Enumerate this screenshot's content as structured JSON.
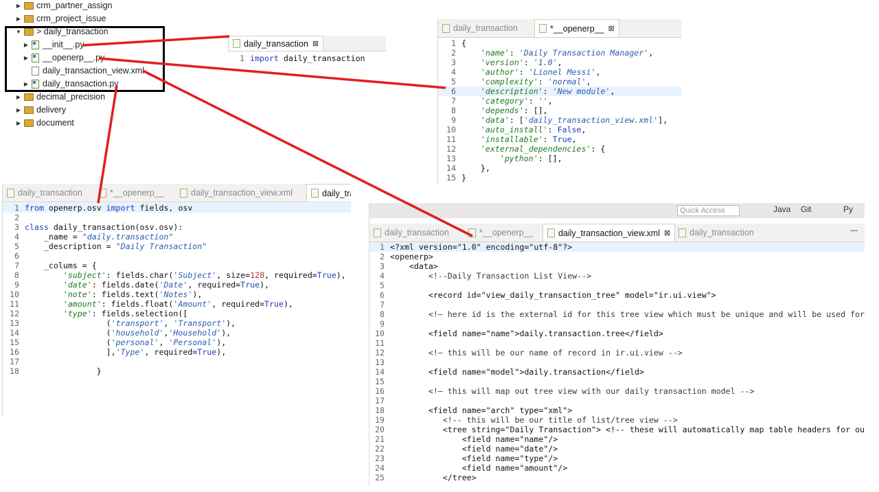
{
  "explorer": {
    "items": [
      {
        "label": "crm_partner_assign",
        "kind": "folder",
        "arrow": "▶"
      },
      {
        "label": "crm_project_issue",
        "kind": "folder",
        "arrow": "▶"
      },
      {
        "label": "> daily_transaction",
        "kind": "folder",
        "arrow": "▼"
      },
      {
        "label": "__init__.py",
        "kind": "py",
        "arrow": "▶"
      },
      {
        "label": "__openerp__.py",
        "kind": "py",
        "arrow": "▶"
      },
      {
        "label": "daily_transaction_view.xml",
        "kind": "xml",
        "arrow": ""
      },
      {
        "label": "daily_transaction.py",
        "kind": "py",
        "arrow": "▶"
      },
      {
        "label": "decimal_precision",
        "kind": "folder",
        "arrow": "▶"
      },
      {
        "label": "delivery",
        "kind": "folder",
        "arrow": "▶"
      },
      {
        "label": "document",
        "kind": "folder",
        "arrow": "▶"
      }
    ]
  },
  "init_editor": {
    "tabs": [
      {
        "label": "daily_transaction",
        "active": true,
        "close": "⊠"
      }
    ],
    "lines": [
      {
        "n": "1",
        "segs": [
          {
            "t": "import",
            "c": "kw"
          },
          {
            "t": " daily_transaction",
            "c": ""
          }
        ]
      }
    ]
  },
  "openerp_editor": {
    "tabs": [
      {
        "label": "daily_transaction",
        "active": false,
        "close": ""
      },
      {
        "label": "*__openerp__",
        "active": true,
        "close": "⊠"
      }
    ],
    "lines": [
      {
        "n": "1",
        "segs": [
          {
            "t": "{",
            "c": ""
          }
        ]
      },
      {
        "n": "2",
        "segs": [
          {
            "t": "    'name'",
            "c": "key"
          },
          {
            "t": ": ",
            "c": ""
          },
          {
            "t": "'Daily Transaction Manager'",
            "c": "str"
          },
          {
            "t": ",",
            "c": ""
          }
        ]
      },
      {
        "n": "3",
        "segs": [
          {
            "t": "    'version'",
            "c": "key"
          },
          {
            "t": ": ",
            "c": ""
          },
          {
            "t": "'1.0'",
            "c": "str"
          },
          {
            "t": ",",
            "c": ""
          }
        ]
      },
      {
        "n": "4",
        "segs": [
          {
            "t": "    'author'",
            "c": "key"
          },
          {
            "t": ": ",
            "c": ""
          },
          {
            "t": "'Lionel Messi'",
            "c": "str"
          },
          {
            "t": ",",
            "c": ""
          }
        ]
      },
      {
        "n": "5",
        "segs": [
          {
            "t": "    'complexity'",
            "c": "key"
          },
          {
            "t": ": ",
            "c": ""
          },
          {
            "t": "'normal'",
            "c": "str"
          },
          {
            "t": ",",
            "c": ""
          }
        ]
      },
      {
        "n": "6",
        "segs": [
          {
            "t": "    'description'",
            "c": "key"
          },
          {
            "t": ": ",
            "c": ""
          },
          {
            "t": "'New module'",
            "c": "str"
          },
          {
            "t": ",",
            "c": ""
          }
        ],
        "current": true
      },
      {
        "n": "7",
        "segs": [
          {
            "t": "    'category'",
            "c": "key"
          },
          {
            "t": ": ",
            "c": ""
          },
          {
            "t": "''",
            "c": "str"
          },
          {
            "t": ",",
            "c": ""
          }
        ]
      },
      {
        "n": "8",
        "segs": [
          {
            "t": "    'depends'",
            "c": "key"
          },
          {
            "t": ": [],",
            "c": ""
          }
        ]
      },
      {
        "n": "9",
        "segs": [
          {
            "t": "    'data'",
            "c": "key"
          },
          {
            "t": ": [",
            "c": ""
          },
          {
            "t": "'daily_transaction_view.xml'",
            "c": "str"
          },
          {
            "t": "],",
            "c": ""
          }
        ]
      },
      {
        "n": "10",
        "segs": [
          {
            "t": "    'auto_install'",
            "c": "key"
          },
          {
            "t": ": ",
            "c": ""
          },
          {
            "t": "False",
            "c": "bool"
          },
          {
            "t": ",",
            "c": ""
          }
        ]
      },
      {
        "n": "11",
        "segs": [
          {
            "t": "    'installable'",
            "c": "key"
          },
          {
            "t": ": ",
            "c": ""
          },
          {
            "t": "True",
            "c": "bool"
          },
          {
            "t": ",",
            "c": ""
          }
        ]
      },
      {
        "n": "12",
        "segs": [
          {
            "t": "    'external_dependencies'",
            "c": "key"
          },
          {
            "t": ": {",
            "c": ""
          }
        ]
      },
      {
        "n": "13",
        "segs": [
          {
            "t": "        'python'",
            "c": "key"
          },
          {
            "t": ": [],",
            "c": ""
          }
        ]
      },
      {
        "n": "14",
        "segs": [
          {
            "t": "    },",
            "c": ""
          }
        ]
      },
      {
        "n": "15",
        "segs": [
          {
            "t": "}",
            "c": ""
          }
        ]
      }
    ]
  },
  "model_editor": {
    "tabs": [
      {
        "label": "daily_transaction",
        "active": false,
        "close": ""
      },
      {
        "label": "*__openerp__",
        "active": false,
        "close": ""
      },
      {
        "label": "daily_transaction_view.xml",
        "active": false,
        "close": ""
      },
      {
        "label": "daily_tra",
        "active": true,
        "close": ""
      }
    ],
    "lines": [
      {
        "n": "1",
        "segs": [
          {
            "t": "from",
            "c": "kw"
          },
          {
            "t": " openerp.osv ",
            "c": ""
          },
          {
            "t": "import",
            "c": "kw"
          },
          {
            "t": " fields, osv",
            "c": ""
          }
        ],
        "current": true
      },
      {
        "n": "2",
        "segs": []
      },
      {
        "n": "3",
        "segs": [
          {
            "t": "class",
            "c": "kw"
          },
          {
            "t": " daily_transaction(osv.osv):",
            "c": ""
          }
        ]
      },
      {
        "n": "4",
        "segs": [
          {
            "t": "    _name = ",
            "c": ""
          },
          {
            "t": "\"daily.transaction\"",
            "c": "str"
          }
        ]
      },
      {
        "n": "5",
        "segs": [
          {
            "t": "    _description = ",
            "c": ""
          },
          {
            "t": "\"Daily Transaction\"",
            "c": "str"
          }
        ]
      },
      {
        "n": "6",
        "segs": []
      },
      {
        "n": "7",
        "segs": [
          {
            "t": "    _colums = {",
            "c": ""
          }
        ]
      },
      {
        "n": "8",
        "segs": [
          {
            "t": "        'subject'",
            "c": "key"
          },
          {
            "t": ": fields.char(",
            "c": ""
          },
          {
            "t": "'Subject'",
            "c": "str"
          },
          {
            "t": ", size=",
            "c": ""
          },
          {
            "t": "128",
            "c": "num"
          },
          {
            "t": ", required=",
            "c": ""
          },
          {
            "t": "True",
            "c": "bool"
          },
          {
            "t": "),",
            "c": ""
          }
        ]
      },
      {
        "n": "9",
        "segs": [
          {
            "t": "        'date'",
            "c": "key"
          },
          {
            "t": ": fields.date(",
            "c": ""
          },
          {
            "t": "'Date'",
            "c": "str"
          },
          {
            "t": ", required=",
            "c": ""
          },
          {
            "t": "True",
            "c": "bool"
          },
          {
            "t": "),",
            "c": ""
          }
        ]
      },
      {
        "n": "10",
        "segs": [
          {
            "t": "        'note'",
            "c": "key"
          },
          {
            "t": ": fields.text(",
            "c": ""
          },
          {
            "t": "'Notes'",
            "c": "str"
          },
          {
            "t": "),",
            "c": ""
          }
        ]
      },
      {
        "n": "11",
        "segs": [
          {
            "t": "        'amount'",
            "c": "key"
          },
          {
            "t": ": fields.float(",
            "c": ""
          },
          {
            "t": "'Amount'",
            "c": "str"
          },
          {
            "t": ", required=",
            "c": ""
          },
          {
            "t": "True",
            "c": "bool"
          },
          {
            "t": "),",
            "c": ""
          }
        ]
      },
      {
        "n": "12",
        "segs": [
          {
            "t": "        'type'",
            "c": "key"
          },
          {
            "t": ": fields.selection([",
            "c": ""
          }
        ]
      },
      {
        "n": "13",
        "segs": [
          {
            "t": "                 (",
            "c": ""
          },
          {
            "t": "'transport'",
            "c": "str"
          },
          {
            "t": ", ",
            "c": ""
          },
          {
            "t": "'Transport'",
            "c": "str"
          },
          {
            "t": "),",
            "c": ""
          }
        ]
      },
      {
        "n": "14",
        "segs": [
          {
            "t": "                 (",
            "c": ""
          },
          {
            "t": "'household'",
            "c": "str"
          },
          {
            "t": ",",
            "c": ""
          },
          {
            "t": "'Household'",
            "c": "str"
          },
          {
            "t": "),",
            "c": ""
          }
        ]
      },
      {
        "n": "15",
        "segs": [
          {
            "t": "                 (",
            "c": ""
          },
          {
            "t": "'personal'",
            "c": "str"
          },
          {
            "t": ", ",
            "c": ""
          },
          {
            "t": "'Personal'",
            "c": "str"
          },
          {
            "t": "),",
            "c": ""
          }
        ]
      },
      {
        "n": "16",
        "segs": [
          {
            "t": "                 ],",
            "c": ""
          },
          {
            "t": "'Type'",
            "c": "str"
          },
          {
            "t": ", required=",
            "c": ""
          },
          {
            "t": "True",
            "c": "bool"
          },
          {
            "t": "),",
            "c": ""
          }
        ]
      },
      {
        "n": "17",
        "segs": []
      },
      {
        "n": "18",
        "segs": [
          {
            "t": "               }",
            "c": ""
          }
        ]
      }
    ]
  },
  "view_editor": {
    "quick_access": "Quick Access",
    "perspectives": [
      "Java",
      "Git",
      "Py"
    ],
    "tabs": [
      {
        "label": "daily_transaction",
        "active": false,
        "close": ""
      },
      {
        "label": "*__openerp__",
        "active": false,
        "close": ""
      },
      {
        "label": "daily_transaction_view.xml",
        "active": true,
        "close": "⊠"
      },
      {
        "label": "daily_transaction",
        "active": false,
        "close": ""
      }
    ],
    "minimize": "—",
    "lines": [
      {
        "n": "1",
        "segs": [
          {
            "t": "<?xml version=\"1.0\" encoding=\"utf-8\"?>",
            "c": ""
          }
        ],
        "current": true
      },
      {
        "n": "2",
        "segs": [
          {
            "t": "<openerp>",
            "c": ""
          }
        ]
      },
      {
        "n": "3",
        "segs": [
          {
            "t": "    <data>",
            "c": ""
          }
        ]
      },
      {
        "n": "4",
        "segs": [
          {
            "t": "        <!--Daily Transaction List View-->",
            "c": "cm"
          }
        ]
      },
      {
        "n": "5",
        "segs": []
      },
      {
        "n": "6",
        "segs": [
          {
            "t": "        <record id=\"view_daily_transaction_tree\" model=\"ir.ui.view\">",
            "c": ""
          }
        ]
      },
      {
        "n": "7",
        "segs": []
      },
      {
        "n": "8",
        "segs": [
          {
            "t": "        <!— here id is the external id for this tree view which must be unique and will be used for acces",
            "c": "cm"
          }
        ]
      },
      {
        "n": "9",
        "segs": []
      },
      {
        "n": "10",
        "segs": [
          {
            "t": "        <field name=\"name\">daily.transaction.tree</field>",
            "c": ""
          }
        ]
      },
      {
        "n": "11",
        "segs": []
      },
      {
        "n": "12",
        "segs": [
          {
            "t": "        <!— this will be our name of record in ir.ui.view -->",
            "c": "cm"
          }
        ]
      },
      {
        "n": "13",
        "segs": []
      },
      {
        "n": "14",
        "segs": [
          {
            "t": "        <field name=\"model\">daily.transaction</field>",
            "c": ""
          }
        ]
      },
      {
        "n": "15",
        "segs": []
      },
      {
        "n": "16",
        "segs": [
          {
            "t": "        <!— this will map out tree view with our daily transaction model -->",
            "c": "cm"
          }
        ]
      },
      {
        "n": "17",
        "segs": []
      },
      {
        "n": "18",
        "segs": [
          {
            "t": "        <field name=\"arch\" type=\"xml\">",
            "c": ""
          }
        ]
      },
      {
        "n": "19",
        "segs": [
          {
            "t": "           <!-- this will be our title of list/tree view -->",
            "c": "cm"
          }
        ]
      },
      {
        "n": "20",
        "segs": [
          {
            "t": "           <tree string=\"Daily Transaction\"> <!-- these will automatically map table headers for our list",
            "c": ""
          }
        ]
      },
      {
        "n": "21",
        "segs": [
          {
            "t": "               <field name=\"name\"/>",
            "c": ""
          }
        ]
      },
      {
        "n": "22",
        "segs": [
          {
            "t": "               <field name=\"date\"/>",
            "c": ""
          }
        ]
      },
      {
        "n": "23",
        "segs": [
          {
            "t": "               <field name=\"type\"/>",
            "c": ""
          }
        ]
      },
      {
        "n": "24",
        "segs": [
          {
            "t": "               <field name=\"amount\"/>",
            "c": ""
          }
        ]
      },
      {
        "n": "25",
        "segs": [
          {
            "t": "           </tree>",
            "c": ""
          }
        ]
      }
    ]
  },
  "colors": {
    "arrow": "#e02020",
    "box": "#000000",
    "current_line": "#e8f2fe"
  }
}
